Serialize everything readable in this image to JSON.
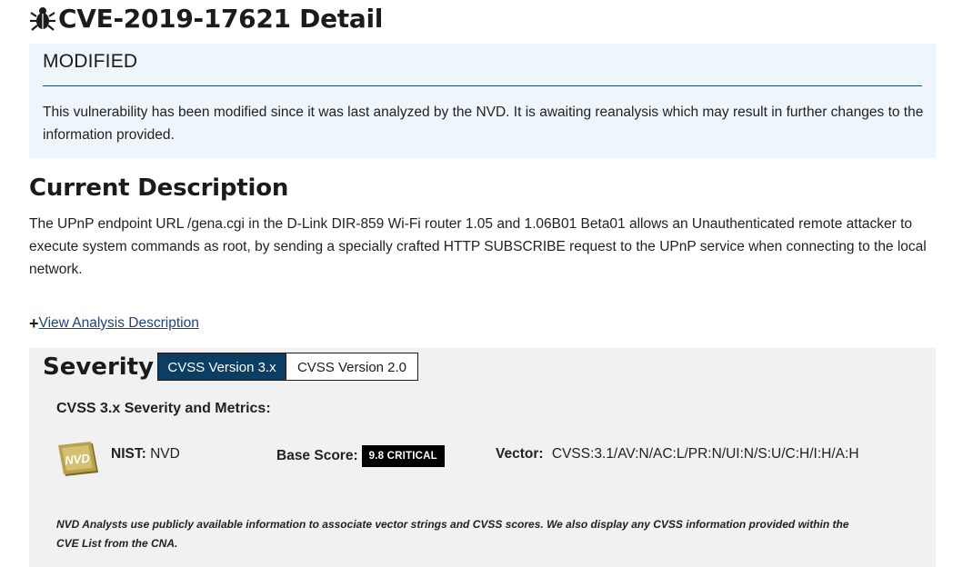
{
  "header": {
    "title": "CVE-2019-17621 Detail",
    "icon": "bug-icon"
  },
  "banner": {
    "heading": "MODIFIED",
    "text": "This vulnerability has been modified since it was last analyzed by the NVD. It is awaiting reanalysis which may result in further changes to the information provided.",
    "background": "#eef5fb"
  },
  "description": {
    "heading": "Current Description",
    "text": "The UPnP endpoint URL /gena.cgi in the D-Link DIR-859 Wi-Fi router 1.05 and 1.06B01 Beta01 allows an Unauthenticated remote attacker to execute system commands as root, by sending a specially crafted HTTP SUBSCRIBE request to the UPnP service when connecting to the local network.",
    "view_analysis_label": "View Analysis Description",
    "link_color": "#1a4480"
  },
  "severity": {
    "heading": "Severity",
    "tabs": [
      {
        "label": "CVSS Version 3.x",
        "active": true
      },
      {
        "label": "CVSS Version 2.0",
        "active": false
      }
    ],
    "active_tab_color": "#0c3d62",
    "metrics_heading": "CVSS 3.x Severity and Metrics:",
    "badge_label": "NVD",
    "nist_label": "NIST:",
    "nist_value": "NVD",
    "base_score_label": "Base Score:",
    "base_score_value": "9.8 CRITICAL",
    "base_score_color": "#000000",
    "vector_label": "Vector:",
    "vector_value": "CVSS:3.1/AV:N/AC:L/PR:N/UI:N/S:U/C:H/I:H/A:H",
    "note": "NVD Analysts use publicly available information to associate vector strings and CVSS scores. We also display any CVSS information provided within the CVE List from the CNA."
  }
}
